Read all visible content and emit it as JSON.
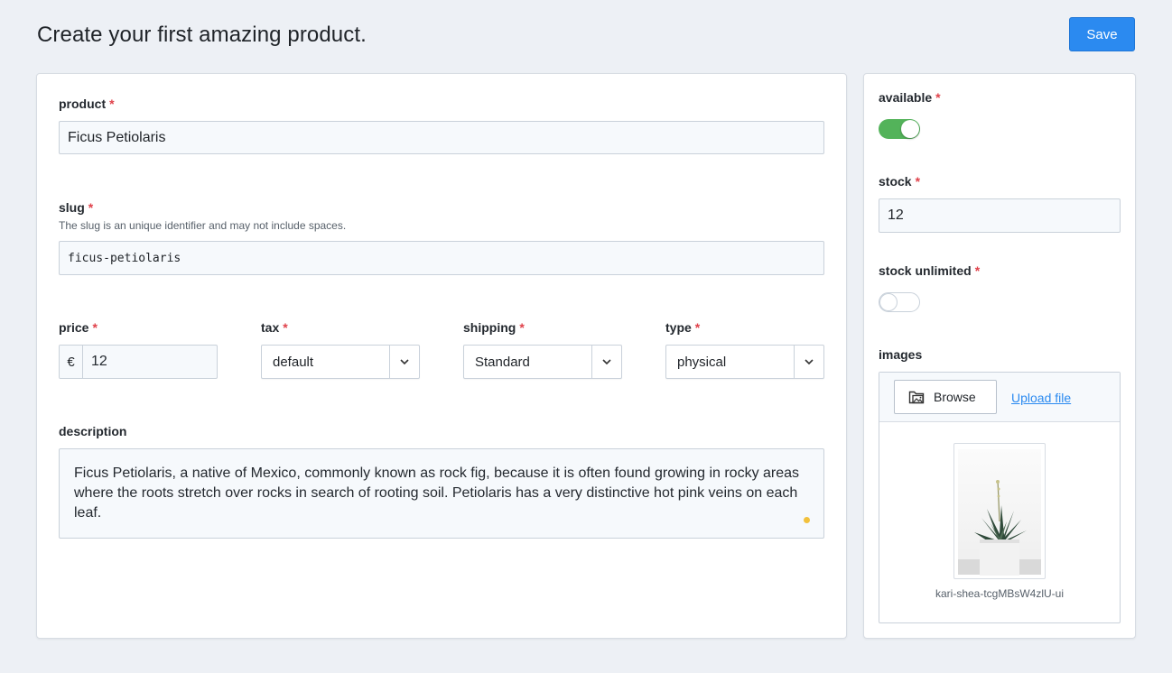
{
  "header": {
    "title": "Create your first amazing product.",
    "save_label": "Save"
  },
  "form": {
    "product": {
      "label": "product",
      "required": "*",
      "value": "Ficus Petiolaris"
    },
    "slug": {
      "label": "slug",
      "required": "*",
      "hint": "The slug is an unique identifier and may not include spaces.",
      "value": "ficus-petiolaris"
    },
    "price": {
      "label": "price",
      "required": "*",
      "currency": "€",
      "value": "12"
    },
    "tax": {
      "label": "tax",
      "required": "*",
      "value": "default"
    },
    "shipping": {
      "label": "shipping",
      "required": "*",
      "value": "Standard"
    },
    "type": {
      "label": "type",
      "required": "*",
      "value": "physical"
    },
    "description": {
      "label": "description",
      "value": "Ficus Petiolaris, a native of Mexico, commonly known as rock fig, because it is often found growing in rocky areas where the roots stretch over rocks in search of rooting soil. Petiolaris has a very distinctive hot pink veins on each leaf."
    }
  },
  "sidebar": {
    "available": {
      "label": "available",
      "required": "*",
      "state": "on"
    },
    "stock": {
      "label": "stock",
      "required": "*",
      "value": "12"
    },
    "stock_unlimited": {
      "label": "stock unlimited",
      "required": "*",
      "state": "off"
    },
    "images": {
      "label": "images",
      "browse_label": "Browse",
      "upload_label": "Upload file",
      "files": [
        {
          "name": "kari-shea-tcgMBsW4zlU-ui"
        }
      ]
    }
  },
  "colors": {
    "accent": "#2b8af0",
    "toggle_on": "#53b35a",
    "required": "#e0424b",
    "unsaved_dot": "#f2c13c"
  }
}
